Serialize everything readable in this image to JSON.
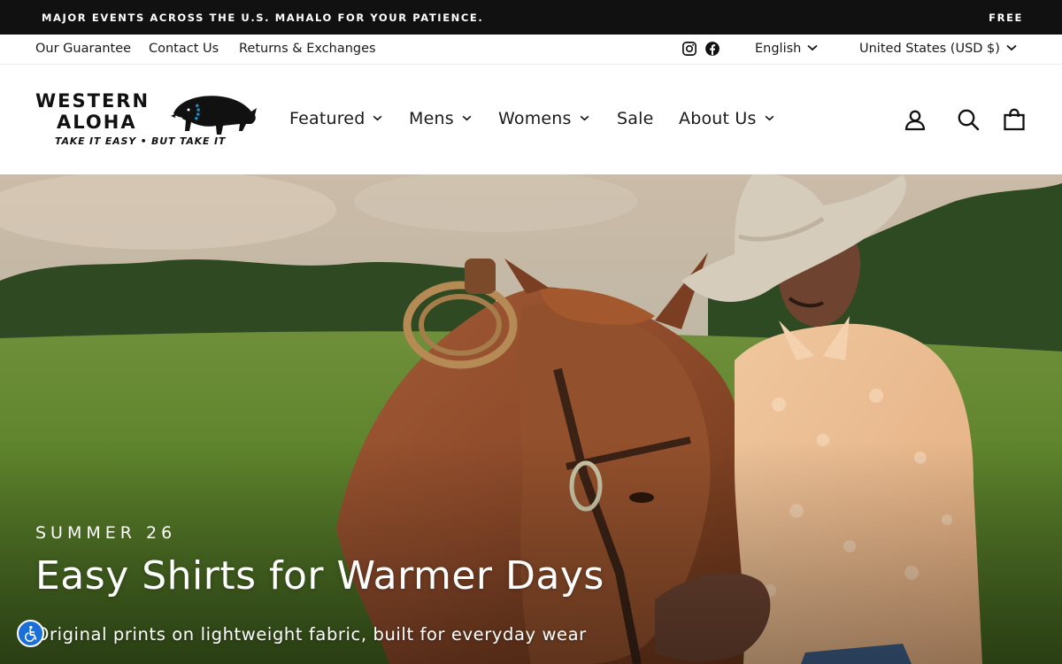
{
  "announcement": {
    "message": "MAJOR EVENTS ACROSS THE U.S. MAHALO FOR YOUR PATIENCE.",
    "secondary": "FREE"
  },
  "utility": {
    "links": [
      "Our Guarantee",
      "Contact Us",
      "Returns & Exchanges"
    ],
    "social": [
      "instagram-icon",
      "facebook-icon"
    ],
    "language": "English",
    "currency": "United States (USD $)"
  },
  "brand": {
    "name_line1": "WESTERN",
    "name_line2": "ALOHA",
    "tagline": "TAKE IT EASY • BUT TAKE IT"
  },
  "nav": {
    "items": [
      {
        "label": "Featured",
        "dropdown": true
      },
      {
        "label": "Mens",
        "dropdown": true
      },
      {
        "label": "Womens",
        "dropdown": true
      },
      {
        "label": "Sale",
        "dropdown": false
      },
      {
        "label": "About Us",
        "dropdown": true
      }
    ],
    "icons": [
      "account-icon",
      "search-icon",
      "cart-icon"
    ]
  },
  "hero": {
    "eyebrow": "SUMMER 26",
    "headline": "Easy Shirts for Warmer Days",
    "subline": "Original prints on lightweight fabric, built for everyday wear"
  },
  "accessibility": {
    "icon": "accessibility-icon"
  },
  "colors": {
    "announcement_bg": "#111111",
    "text": "#1a1a1a",
    "accessibility_button": "#1b6fd8"
  }
}
